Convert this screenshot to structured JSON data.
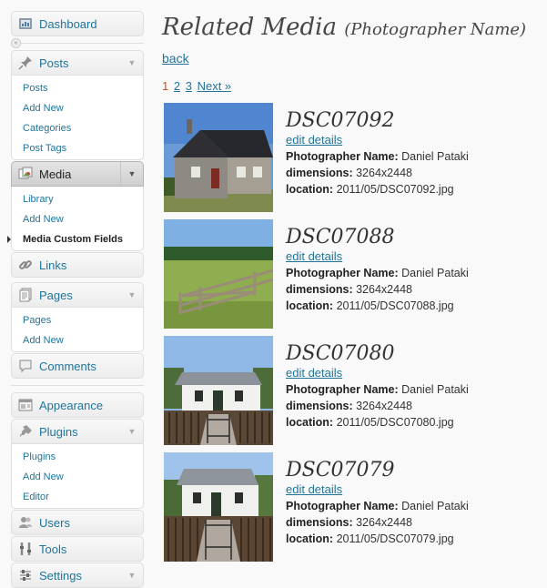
{
  "sidebar": {
    "dashboard": "Dashboard",
    "posts": {
      "label": "Posts",
      "items": [
        "Posts",
        "Add New",
        "Categories",
        "Post Tags"
      ]
    },
    "media": {
      "label": "Media",
      "items": [
        "Library",
        "Add New",
        "Media Custom Fields"
      ]
    },
    "links": "Links",
    "pages": {
      "label": "Pages",
      "items": [
        "Pages",
        "Add New"
      ]
    },
    "comments": "Comments",
    "appearance": "Appearance",
    "plugins": {
      "label": "Plugins",
      "items": [
        "Plugins",
        "Add New",
        "Editor"
      ]
    },
    "users": "Users",
    "tools": "Tools",
    "settings": "Settings"
  },
  "main": {
    "title": "Related Media",
    "subtitle": "(Photographer Name)",
    "back": "back",
    "pagination": {
      "current": "1",
      "pages": [
        "2",
        "3"
      ],
      "next": "Next »"
    },
    "labels": {
      "edit": "edit details",
      "photographer": "Photographer Name:",
      "dimensions": "dimensions:",
      "location": "location:"
    },
    "items": [
      {
        "title": "DSC07092",
        "photographer": "Daniel Pataki",
        "dimensions": "3264x2448",
        "location": "2011/05/DSC07092.jpg"
      },
      {
        "title": "DSC07088",
        "photographer": "Daniel Pataki",
        "dimensions": "3264x2448",
        "location": "2011/05/DSC07088.jpg"
      },
      {
        "title": "DSC07080",
        "photographer": "Daniel Pataki",
        "dimensions": "3264x2448",
        "location": "2011/05/DSC07080.jpg"
      },
      {
        "title": "DSC07079",
        "photographer": "Daniel Pataki",
        "dimensions": "3264x2448",
        "location": "2011/05/DSC07079.jpg"
      }
    ]
  },
  "colors": {
    "link": "#21759b",
    "current_page": "#d54e21",
    "background": "#f9f9f9"
  }
}
